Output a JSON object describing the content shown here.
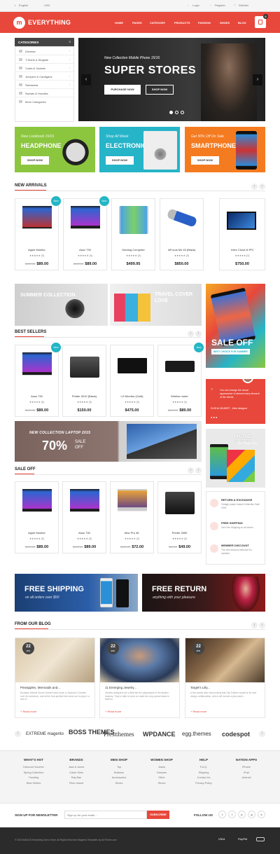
{
  "topbar": {
    "language": "English",
    "currency": "USD",
    "login": "Login",
    "register": "Register",
    "wishlist": "Wishlist"
  },
  "header": {
    "logo_letter": "m",
    "logo": "EVERYTHING",
    "nav": [
      "HOME",
      "PAGES",
      "CATEGORY",
      "PRODUCTS",
      "FASHION",
      "SHOES",
      "BLOG"
    ],
    "cart_count": "0"
  },
  "categories": {
    "title": "CATEGORIES",
    "items": [
      "Dresses",
      "T-Shirts & Singlets",
      "Coats & Jackets",
      "Jumpers & Cardigans",
      "Swimwear",
      "Sweats & Hoodies",
      "More Categories"
    ]
  },
  "hero": {
    "subtitle": "New Collection Mobile Phone 15/16",
    "title": "SUPER STORES",
    "btn_purchase": "PURCHASE NOW",
    "btn_shop": "SHOP NOW",
    "prev": "‹",
    "next": "›"
  },
  "promos": [
    {
      "sub": "New Lookbook 15/16",
      "title": "HEADPHONE",
      "btn": "SHOP NOW",
      "color": "#8cc63f"
    },
    {
      "sub": "Shop All Week",
      "title": "ELECTRONICS",
      "btn": "SHOP NOW",
      "color": "#26b4c8"
    },
    {
      "sub": "Get 50% Off On Sale",
      "title": "SMARTPHONES",
      "btn": "SHOP NOW",
      "color": "#f47b20"
    }
  ],
  "new_arrivals": {
    "title": "NEW ARRIVALS",
    "products": [
      {
        "name": "Apple Monitor",
        "stars": "★★★★★ (0)",
        "old": "$100.00",
        "price": "$89.00",
        "badge": "New"
      },
      {
        "name": "Asuz 730",
        "stars": "★★★★★ (0)",
        "old": "$100.00",
        "price": "$89.00",
        "badge": "New"
      },
      {
        "name": "Gaming Computer",
        "stars": "★★★★★ (0)",
        "old": "",
        "price": "$499.95",
        "badge": ""
      },
      {
        "name": "InFocus Mz 45 (Black)",
        "stars": "★★★★★ (0)",
        "old": "",
        "price": "$850.00",
        "badge": ""
      },
      {
        "name": "Intex Cloud N IPS",
        "stars": "★★★★★ (0)",
        "old": "",
        "price": "$750.00",
        "badge": ""
      }
    ]
  },
  "mid_banners": {
    "summer": "SUMMER COLLECTION",
    "summer_sub": "Lookbook 15/16",
    "travel": "TRAVEL COVER LOVE",
    "travel_sub": "Get 20% Off On Sale"
  },
  "best_sellers": {
    "title": "BEST SELLERS",
    "products": [
      {
        "name": "Asuz 730",
        "stars": "★★★★★ (0)",
        "old": "$100.00",
        "price": "$89.00",
        "badge": "New"
      },
      {
        "name": "Printer 5210 (Black)",
        "stars": "★★★★★ (0)",
        "old": "",
        "price": "$150.00",
        "badge": ""
      },
      {
        "name": "LG Monitor (Gold)",
        "stars": "★★★★★ (0)",
        "old": "",
        "price": "$475.00",
        "badge": ""
      },
      {
        "name": "Wirelss router",
        "stars": "★★★★★ (0)",
        "old": "$100.00",
        "price": "$89.00",
        "badge": "New"
      }
    ]
  },
  "laptop_banner": {
    "title": "NEW COLLECTION LAPTOP 2015",
    "pct": "70%",
    "sale": "SALE",
    "off": "OFF"
  },
  "sale_off": {
    "title": "SALE OFF",
    "products": [
      {
        "name": "Apple Monitor",
        "stars": "★★★★★ (0)",
        "old": "$100.00",
        "price": "$89.00"
      },
      {
        "name": "Asuz 730",
        "stars": "★★★★★ (0)",
        "old": "$100.00",
        "price": "$89.00"
      },
      {
        "name": "Mac Pro 4K",
        "stars": "★★★★★ (0)",
        "old": "$120.00",
        "price": "$72.00"
      },
      {
        "name": "Printer 3050",
        "stars": "★★★★★ (0)",
        "old": "$60.00",
        "price": "$49.00"
      }
    ]
  },
  "right_col": {
    "sale_off": "SALE OFF",
    "sale_sub": "BEST CHOICE FOR SUMMER",
    "quote": "You can change the visual appearance of almost every element of the theme.",
    "quote_author": "SUSHA GILBERT - Web designer",
    "phone_cases": "PHONE CASES",
    "phone_sub": "Get Ready Now",
    "services": [
      {
        "title": "RETURN & EXCHANGE",
        "desc": "Vintage poster tucked Collection Sale 2015"
      },
      {
        "title": "FREE SHIPPING",
        "desc": "Get Free Shipping on all orders"
      },
      {
        "title": "MEMBER DISCOUNT",
        "desc": "The new discount discount for member"
      }
    ]
  },
  "shipping": {
    "free_shipping": "FREE SHIPPING",
    "free_shipping_sub": "on all orders over $50",
    "free_return": "FREE RETURN",
    "free_return_sub": "anything with your pleasure"
  },
  "blog": {
    "title": "FROM OUR BLOG",
    "posts": [
      {
        "day": "22",
        "mon": "JUL",
        "title": "Pineapples, Mermaids and...",
        "desc": "Boutique festival Secret Garden went down in Sydney's Camden over the weekend, and all the free-spirited folk came out to play in a sea of...",
        "more": "+ Read more"
      },
      {
        "day": "22",
        "mon": "JUL",
        "title": "11 Emerging Jewelry...",
        "desc": "Jewelry designers are a little like the playwrights of the fashion industry. They're able to work on small but very special tasks to fashion...",
        "more": "+ Read more"
      },
      {
        "day": "22",
        "mon": "JUL",
        "title": "Target's Lilly...",
        "desc": "A few weeks after announcing that Lilly Pulitzer would be its next design collaboration, which will include a plus-sized...",
        "more": "+ Read more"
      }
    ]
  },
  "brands": [
    "EXTREME magento",
    "BOSS THEMES",
    "Prestthemes",
    "WPDANCE",
    "egg.themes",
    "codespot"
  ],
  "footer": {
    "cols": [
      {
        "h": "WHAT'S HOT",
        "items": [
          "Discount Voucher",
          "Spring Collection",
          "Trending",
          "Best Sellers"
        ]
      },
      {
        "h": "BRANDS",
        "items": [
          "Jack & Jones",
          "Calvin Klein",
          "Ray Ban",
          "River Island"
        ]
      },
      {
        "h": "MEN SHOP",
        "items": [
          "Top",
          "Bottoms",
          "Accessories",
          "Shoes"
        ]
      },
      {
        "h": "WOMEN SHOP",
        "items": [
          "Jeans",
          "Dresses",
          "Other",
          "Shoes"
        ]
      },
      {
        "h": "HELP",
        "items": [
          "F.A.Q.",
          "Shipping",
          "Contact Us",
          "Privacy Policy"
        ]
      },
      {
        "h": "NATION APPS",
        "items": [
          "iPhone",
          "iPad",
          "Android"
        ]
      }
    ],
    "newsletter_label": "SIGN UP FOR NEWSLETTER",
    "newsletter_placeholder": "Sign up for your email ...",
    "subscribe": "SUBSCRIBE",
    "follow": "FOLLOW US",
    "social": [
      "t",
      "f",
      "p",
      "g",
      "s"
    ],
    "copyright": "© 2015 MAGUS Everything Demo Store. All Rights Reserved Magento Templates by ArrTheme.com",
    "payments": [
      "VISA",
      "PayPal"
    ]
  }
}
